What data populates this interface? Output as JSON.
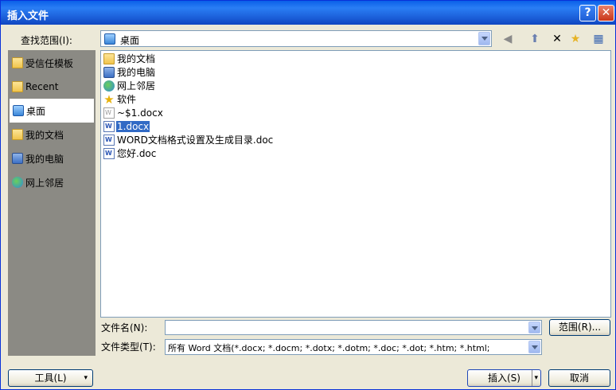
{
  "window": {
    "title": "插入文件",
    "help": "?",
    "close": "✕"
  },
  "lookin": {
    "label": "查找范围(I):",
    "value": "桌面"
  },
  "toolbar": {
    "back": "◀",
    "up": "⬆",
    "delete": "✕",
    "newfolder": "★",
    "views": "▦"
  },
  "places": [
    {
      "label": "受信任模板",
      "icon": "folder-icon"
    },
    {
      "label": "Recent",
      "icon": "folder-icon"
    },
    {
      "label": "桌面",
      "icon": "desktop-icon"
    },
    {
      "label": "我的文档",
      "icon": "documents-icon"
    },
    {
      "label": "我的电脑",
      "icon": "computer-icon"
    },
    {
      "label": "网上邻居",
      "icon": "network-icon"
    }
  ],
  "files": [
    {
      "name": "我的文档",
      "type": "folder"
    },
    {
      "name": "我的电脑",
      "type": "computer"
    },
    {
      "name": "网上邻居",
      "type": "network"
    },
    {
      "name": "软件",
      "type": "star"
    },
    {
      "name": "~$1.docx",
      "type": "docgray"
    },
    {
      "name": "1.docx",
      "type": "doc",
      "selected": true
    },
    {
      "name": "WORD文档格式设置及生成目录.doc",
      "type": "doc"
    },
    {
      "name": "您好.doc",
      "type": "doc"
    }
  ],
  "filename": {
    "label": "文件名(N):",
    "value": ""
  },
  "filetype": {
    "label": "文件类型(T):",
    "value": "所有 Word 文档(*.docx; *.docm; *.dotx; *.dotm; *.doc; *.dot; *.htm; *.html;"
  },
  "buttons": {
    "range": "范围(R)...",
    "tools": "工具(L)",
    "insert": "插入(S)",
    "cancel": "取消"
  }
}
